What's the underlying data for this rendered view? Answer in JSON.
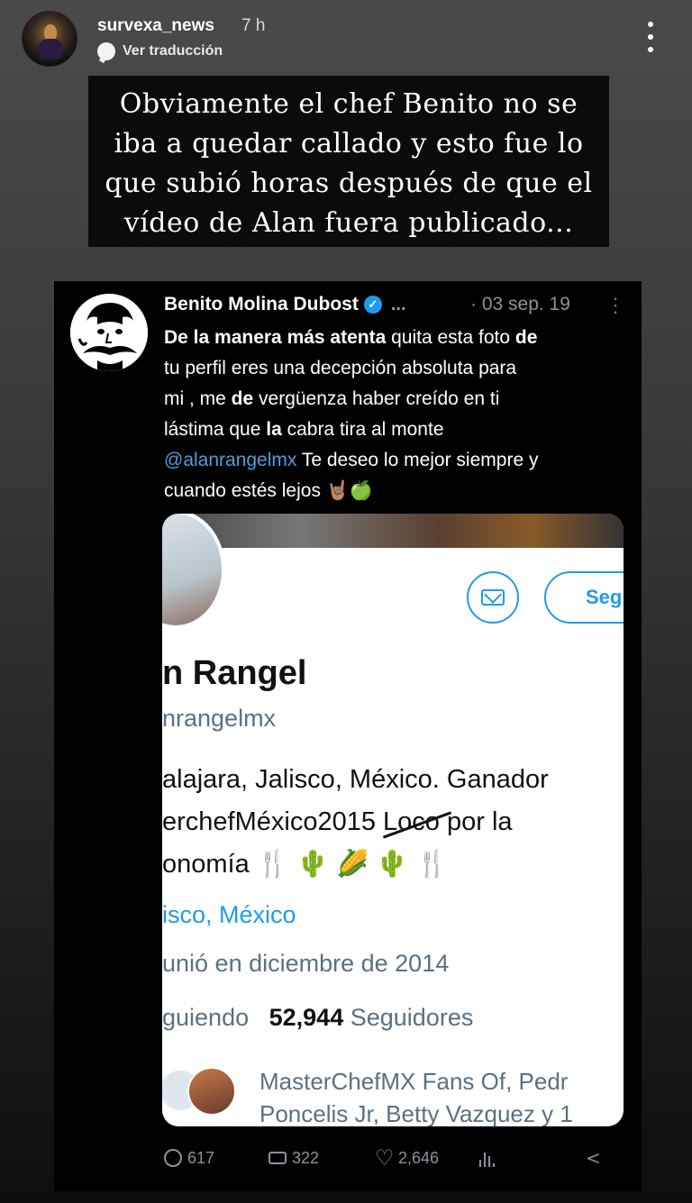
{
  "story": {
    "username": "survexa_news",
    "time": "7 h",
    "translate_label": "Ver traducción",
    "caption_lines": [
      "Obviamente el chef Benito no se",
      "iba a quedar callado y esto fue lo",
      "que subió horas después de que el",
      "vídeo de Alan fuera publicado..."
    ]
  },
  "tweet": {
    "author": "Benito Molina Dubost",
    "ellipsis": "...",
    "date": "· 03 sep. 19",
    "more": "⋮",
    "body": {
      "l1_b": "De la manera más atenta",
      "l1_r": " quita esta foto ",
      "l1_b2": "de",
      "l2": "tu perfil eres una decepción absoluta para",
      "l3a": "mi , me ",
      "l3b": "de",
      "l3c": " vergüenza haber creído en ti",
      "l4a": "lástima que ",
      "l4b": "la",
      "l4c": " cabra tira al monte",
      "mention": "@alanrangelmx",
      "l5": "  Te deseo lo mejor siempre y",
      "l6": "cuando estés lejos 🤘🏽🍏"
    },
    "embedded_profile": {
      "follow_partial": "Seg",
      "name_partial": "n Rangel",
      "handle_partial": "nrangelmx",
      "bio_lines": [
        "alajara, Jalisco, México. Ganador",
        "erchefMéxico2015 ",
        "onomía 🍴 🌵 🌽 🌵 🍴"
      ],
      "bio_struck": "Loco",
      "bio_after_struck": " por la",
      "location_partial": "isco, México",
      "joined_partial": "unió en diciembre de 2014",
      "following_partial": "guiendo",
      "followers_count": "52,944",
      "followers_label": "Seguidores",
      "followed_by_1": "MasterChefMX Fans Of, Pedr",
      "followed_by_2": "Poncelis Jr, Betty Vazquez y 1"
    },
    "stats": {
      "replies": "617",
      "retweets": "322",
      "likes": "2,646"
    }
  }
}
